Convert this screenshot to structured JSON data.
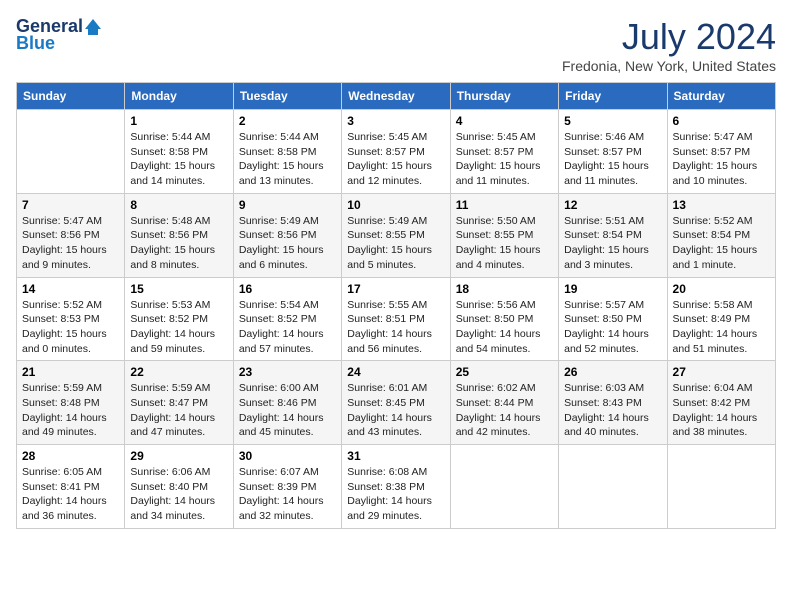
{
  "header": {
    "logo_general": "General",
    "logo_blue": "Blue",
    "month_year": "July 2024",
    "location": "Fredonia, New York, United States"
  },
  "days_of_week": [
    "Sunday",
    "Monday",
    "Tuesday",
    "Wednesday",
    "Thursday",
    "Friday",
    "Saturday"
  ],
  "weeks": [
    [
      {
        "day": "",
        "sunrise": "",
        "sunset": "",
        "daylight": ""
      },
      {
        "day": "1",
        "sunrise": "Sunrise: 5:44 AM",
        "sunset": "Sunset: 8:58 PM",
        "daylight": "Daylight: 15 hours and 14 minutes."
      },
      {
        "day": "2",
        "sunrise": "Sunrise: 5:44 AM",
        "sunset": "Sunset: 8:58 PM",
        "daylight": "Daylight: 15 hours and 13 minutes."
      },
      {
        "day": "3",
        "sunrise": "Sunrise: 5:45 AM",
        "sunset": "Sunset: 8:57 PM",
        "daylight": "Daylight: 15 hours and 12 minutes."
      },
      {
        "day": "4",
        "sunrise": "Sunrise: 5:45 AM",
        "sunset": "Sunset: 8:57 PM",
        "daylight": "Daylight: 15 hours and 11 minutes."
      },
      {
        "day": "5",
        "sunrise": "Sunrise: 5:46 AM",
        "sunset": "Sunset: 8:57 PM",
        "daylight": "Daylight: 15 hours and 11 minutes."
      },
      {
        "day": "6",
        "sunrise": "Sunrise: 5:47 AM",
        "sunset": "Sunset: 8:57 PM",
        "daylight": "Daylight: 15 hours and 10 minutes."
      }
    ],
    [
      {
        "day": "7",
        "sunrise": "Sunrise: 5:47 AM",
        "sunset": "Sunset: 8:56 PM",
        "daylight": "Daylight: 15 hours and 9 minutes."
      },
      {
        "day": "8",
        "sunrise": "Sunrise: 5:48 AM",
        "sunset": "Sunset: 8:56 PM",
        "daylight": "Daylight: 15 hours and 8 minutes."
      },
      {
        "day": "9",
        "sunrise": "Sunrise: 5:49 AM",
        "sunset": "Sunset: 8:56 PM",
        "daylight": "Daylight: 15 hours and 6 minutes."
      },
      {
        "day": "10",
        "sunrise": "Sunrise: 5:49 AM",
        "sunset": "Sunset: 8:55 PM",
        "daylight": "Daylight: 15 hours and 5 minutes."
      },
      {
        "day": "11",
        "sunrise": "Sunrise: 5:50 AM",
        "sunset": "Sunset: 8:55 PM",
        "daylight": "Daylight: 15 hours and 4 minutes."
      },
      {
        "day": "12",
        "sunrise": "Sunrise: 5:51 AM",
        "sunset": "Sunset: 8:54 PM",
        "daylight": "Daylight: 15 hours and 3 minutes."
      },
      {
        "day": "13",
        "sunrise": "Sunrise: 5:52 AM",
        "sunset": "Sunset: 8:54 PM",
        "daylight": "Daylight: 15 hours and 1 minute."
      }
    ],
    [
      {
        "day": "14",
        "sunrise": "Sunrise: 5:52 AM",
        "sunset": "Sunset: 8:53 PM",
        "daylight": "Daylight: 15 hours and 0 minutes."
      },
      {
        "day": "15",
        "sunrise": "Sunrise: 5:53 AM",
        "sunset": "Sunset: 8:52 PM",
        "daylight": "Daylight: 14 hours and 59 minutes."
      },
      {
        "day": "16",
        "sunrise": "Sunrise: 5:54 AM",
        "sunset": "Sunset: 8:52 PM",
        "daylight": "Daylight: 14 hours and 57 minutes."
      },
      {
        "day": "17",
        "sunrise": "Sunrise: 5:55 AM",
        "sunset": "Sunset: 8:51 PM",
        "daylight": "Daylight: 14 hours and 56 minutes."
      },
      {
        "day": "18",
        "sunrise": "Sunrise: 5:56 AM",
        "sunset": "Sunset: 8:50 PM",
        "daylight": "Daylight: 14 hours and 54 minutes."
      },
      {
        "day": "19",
        "sunrise": "Sunrise: 5:57 AM",
        "sunset": "Sunset: 8:50 PM",
        "daylight": "Daylight: 14 hours and 52 minutes."
      },
      {
        "day": "20",
        "sunrise": "Sunrise: 5:58 AM",
        "sunset": "Sunset: 8:49 PM",
        "daylight": "Daylight: 14 hours and 51 minutes."
      }
    ],
    [
      {
        "day": "21",
        "sunrise": "Sunrise: 5:59 AM",
        "sunset": "Sunset: 8:48 PM",
        "daylight": "Daylight: 14 hours and 49 minutes."
      },
      {
        "day": "22",
        "sunrise": "Sunrise: 5:59 AM",
        "sunset": "Sunset: 8:47 PM",
        "daylight": "Daylight: 14 hours and 47 minutes."
      },
      {
        "day": "23",
        "sunrise": "Sunrise: 6:00 AM",
        "sunset": "Sunset: 8:46 PM",
        "daylight": "Daylight: 14 hours and 45 minutes."
      },
      {
        "day": "24",
        "sunrise": "Sunrise: 6:01 AM",
        "sunset": "Sunset: 8:45 PM",
        "daylight": "Daylight: 14 hours and 43 minutes."
      },
      {
        "day": "25",
        "sunrise": "Sunrise: 6:02 AM",
        "sunset": "Sunset: 8:44 PM",
        "daylight": "Daylight: 14 hours and 42 minutes."
      },
      {
        "day": "26",
        "sunrise": "Sunrise: 6:03 AM",
        "sunset": "Sunset: 8:43 PM",
        "daylight": "Daylight: 14 hours and 40 minutes."
      },
      {
        "day": "27",
        "sunrise": "Sunrise: 6:04 AM",
        "sunset": "Sunset: 8:42 PM",
        "daylight": "Daylight: 14 hours and 38 minutes."
      }
    ],
    [
      {
        "day": "28",
        "sunrise": "Sunrise: 6:05 AM",
        "sunset": "Sunset: 8:41 PM",
        "daylight": "Daylight: 14 hours and 36 minutes."
      },
      {
        "day": "29",
        "sunrise": "Sunrise: 6:06 AM",
        "sunset": "Sunset: 8:40 PM",
        "daylight": "Daylight: 14 hours and 34 minutes."
      },
      {
        "day": "30",
        "sunrise": "Sunrise: 6:07 AM",
        "sunset": "Sunset: 8:39 PM",
        "daylight": "Daylight: 14 hours and 32 minutes."
      },
      {
        "day": "31",
        "sunrise": "Sunrise: 6:08 AM",
        "sunset": "Sunset: 8:38 PM",
        "daylight": "Daylight: 14 hours and 29 minutes."
      },
      {
        "day": "",
        "sunrise": "",
        "sunset": "",
        "daylight": ""
      },
      {
        "day": "",
        "sunrise": "",
        "sunset": "",
        "daylight": ""
      },
      {
        "day": "",
        "sunrise": "",
        "sunset": "",
        "daylight": ""
      }
    ]
  ]
}
